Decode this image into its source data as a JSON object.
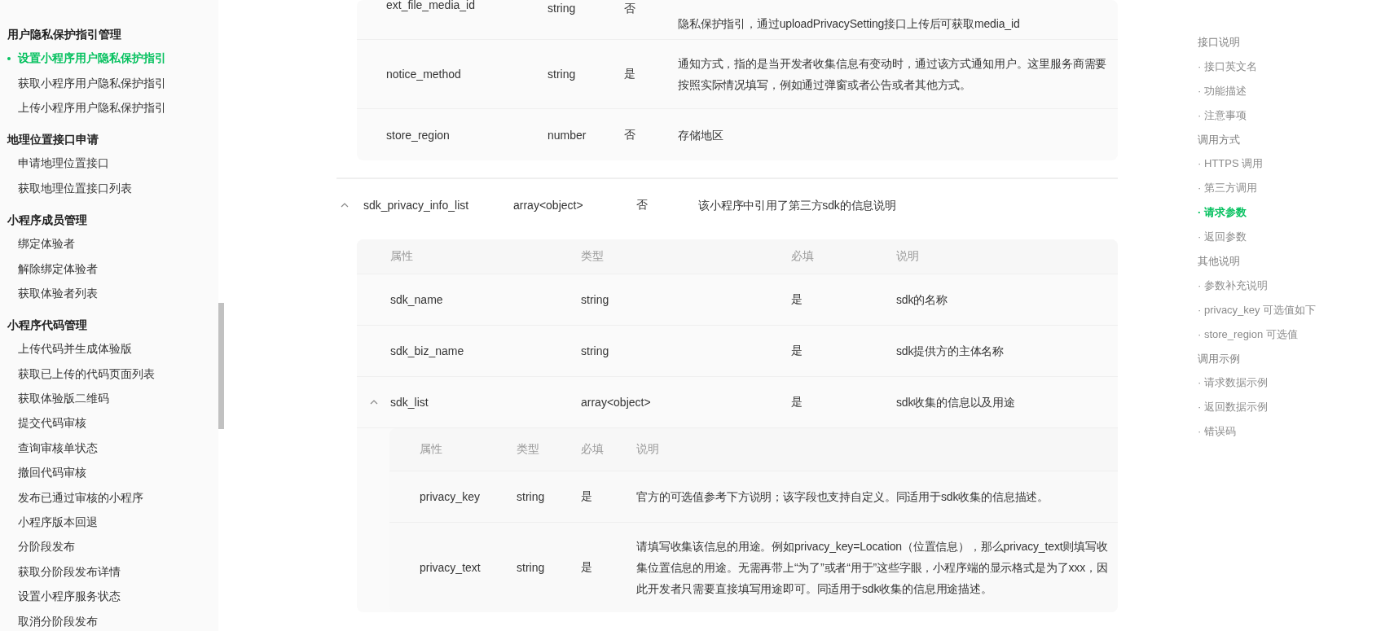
{
  "sidebar": {
    "groups": [
      {
        "title": "用户隐私保护指引管理",
        "items": [
          {
            "label": "设置小程序用户隐私保护指引",
            "selected": true
          },
          {
            "label": "获取小程序用户隐私保护指引",
            "selected": false
          },
          {
            "label": "上传小程序用户隐私保护指引",
            "selected": false
          }
        ]
      },
      {
        "title": "地理位置接口申请",
        "items": [
          {
            "label": "申请地理位置接口",
            "selected": false
          },
          {
            "label": "获取地理位置接口列表",
            "selected": false
          }
        ]
      },
      {
        "title": "小程序成员管理",
        "items": [
          {
            "label": "绑定体验者",
            "selected": false
          },
          {
            "label": "解除绑定体验者",
            "selected": false
          },
          {
            "label": "获取体验者列表",
            "selected": false
          }
        ]
      },
      {
        "title": "小程序代码管理",
        "items": [
          {
            "label": "上传代码并生成体验版",
            "selected": false
          },
          {
            "label": "获取已上传的代码页面列表",
            "selected": false
          },
          {
            "label": "获取体验版二维码",
            "selected": false
          },
          {
            "label": "提交代码审核",
            "selected": false
          },
          {
            "label": "查询审核单状态",
            "selected": false
          },
          {
            "label": "撤回代码审核",
            "selected": false
          },
          {
            "label": "发布已通过审核的小程序",
            "selected": false
          },
          {
            "label": "小程序版本回退",
            "selected": false
          },
          {
            "label": "分阶段发布",
            "selected": false
          },
          {
            "label": "获取分阶段发布详情",
            "selected": false
          },
          {
            "label": "设置小程序服务状态",
            "selected": false
          },
          {
            "label": "取消分阶段发布",
            "selected": false
          }
        ]
      }
    ]
  },
  "upper_table": {
    "rows": [
      {
        "name": "ext_file_media_id",
        "type": "string",
        "required": "否",
        "description": "隐私保护指引，通过uploadPrivacySetting接口上传后可获取media_id"
      },
      {
        "name": "notice_method",
        "type": "string",
        "required": "是",
        "description": "通知方式，指的是当开发者收集信息有变动时，通过该方式通知用户。这里服务商需要按照实际情况填写，例如通过弹窗或者公告或者其他方式。"
      },
      {
        "name": "store_region",
        "type": "number",
        "required": "否",
        "description": "存储地区"
      }
    ]
  },
  "params": [
    {
      "name": "sdk_privacy_info_list",
      "type": "array<object>",
      "required": "否",
      "description": "该小程序中引用了第三方sdk的信息说明",
      "expanded": true,
      "children": {
        "columns": [
          "属性",
          "类型",
          "必填",
          "说明"
        ],
        "rows": [
          {
            "name": "sdk_name",
            "type": "string",
            "required": "是",
            "description": "sdk的名称"
          },
          {
            "name": "sdk_biz_name",
            "type": "string",
            "required": "是",
            "description": "sdk提供方的主体名称"
          },
          {
            "name": "sdk_list",
            "type": "array<object>",
            "required": "是",
            "description": "sdk收集的信息以及用途",
            "expanded": true,
            "children": {
              "columns": [
                "属性",
                "类型",
                "必填",
                "说明"
              ],
              "rows": [
                {
                  "name": "privacy_key",
                  "type": "string",
                  "required": "是",
                  "description": "官方的可选值参考下方说明；该字段也支持自定义。同适用于sdk收集的信息描述。"
                },
                {
                  "name": "privacy_text",
                  "type": "string",
                  "required": "是",
                  "description": "请填写收集该信息的用途。例如privacy_key=Location（位置信息），那么privacy_text则填写收集位置信息的用途。无需再带上“为了”或者“用于”这些字眼，小程序端的显示格式是为了xxx，因此开发者只需要直接填写用途即可。同适用于sdk收集的信息用途描述。"
                }
              ]
            }
          }
        ]
      }
    }
  ],
  "toc": {
    "items": [
      {
        "label": "接口说明",
        "kind": "section",
        "selected": false
      },
      {
        "label": "· 接口英文名",
        "kind": "sub",
        "selected": false
      },
      {
        "label": "· 功能描述",
        "kind": "sub",
        "selected": false
      },
      {
        "label": "· 注意事项",
        "kind": "sub",
        "selected": false
      },
      {
        "label": "调用方式",
        "kind": "section",
        "selected": false
      },
      {
        "label": "· HTTPS 调用",
        "kind": "sub",
        "selected": false
      },
      {
        "label": "· 第三方调用",
        "kind": "sub",
        "selected": false
      },
      {
        "label": "· 请求参数",
        "kind": "sub",
        "selected": true
      },
      {
        "label": "· 返回参数",
        "kind": "sub",
        "selected": false
      },
      {
        "label": "其他说明",
        "kind": "section",
        "selected": false
      },
      {
        "label": "· 参数补充说明",
        "kind": "sub",
        "selected": false
      },
      {
        "label": "· privacy_key 可选值如下",
        "kind": "sub",
        "selected": false
      },
      {
        "label": "· store_region 可选值",
        "kind": "sub",
        "selected": false
      },
      {
        "label": "调用示例",
        "kind": "section",
        "selected": false
      },
      {
        "label": "· 请求数据示例",
        "kind": "sub",
        "selected": false
      },
      {
        "label": "· 返回数据示例",
        "kind": "sub",
        "selected": false
      },
      {
        "label": "· 错误码",
        "kind": "sub",
        "selected": false
      }
    ]
  }
}
